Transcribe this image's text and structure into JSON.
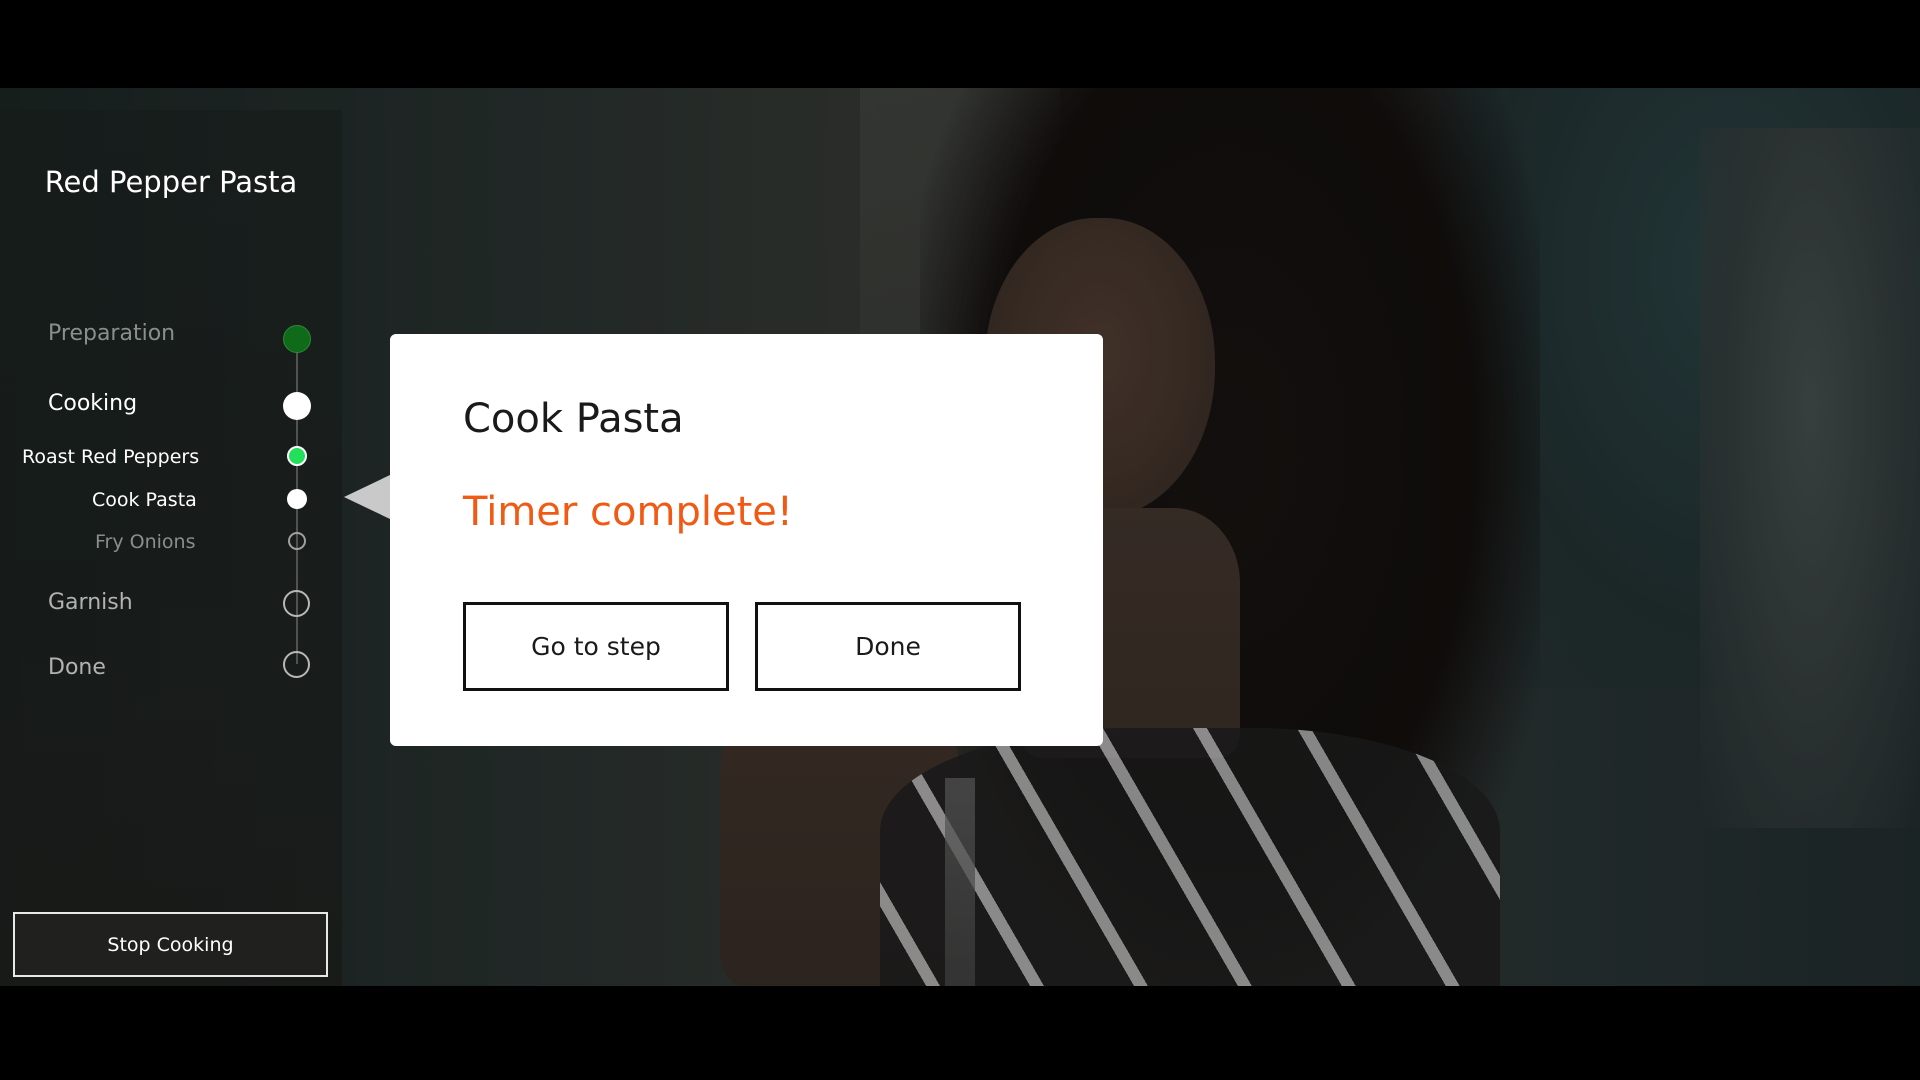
{
  "recipe": {
    "title": "Red Pepper Pasta"
  },
  "steps": [
    {
      "label": "Preparation",
      "state": "complete",
      "color": "#0f6a1a"
    },
    {
      "label": "Cooking",
      "state": "current",
      "color": "#ffffff"
    },
    {
      "label": "Roast Red Peppers",
      "state": "active-timer",
      "color": "#22e05a"
    },
    {
      "label": "Cook Pasta",
      "state": "current",
      "color": "#ffffff"
    },
    {
      "label": "Fry Onions",
      "state": "upcoming",
      "color": "#bbbbbb"
    },
    {
      "label": "Garnish",
      "state": "upcoming",
      "color": "#bbbbbb"
    },
    {
      "label": "Done",
      "state": "upcoming",
      "color": "#bbbbbb"
    }
  ],
  "dialog": {
    "title": "Cook Pasta",
    "message": "Timer complete!",
    "go_to_step_label": "Go to step",
    "done_label": "Done",
    "message_color": "#f05a14"
  },
  "stop_cooking_label": "Stop Cooking",
  "background": {
    "description_icon": "video-still-background"
  }
}
